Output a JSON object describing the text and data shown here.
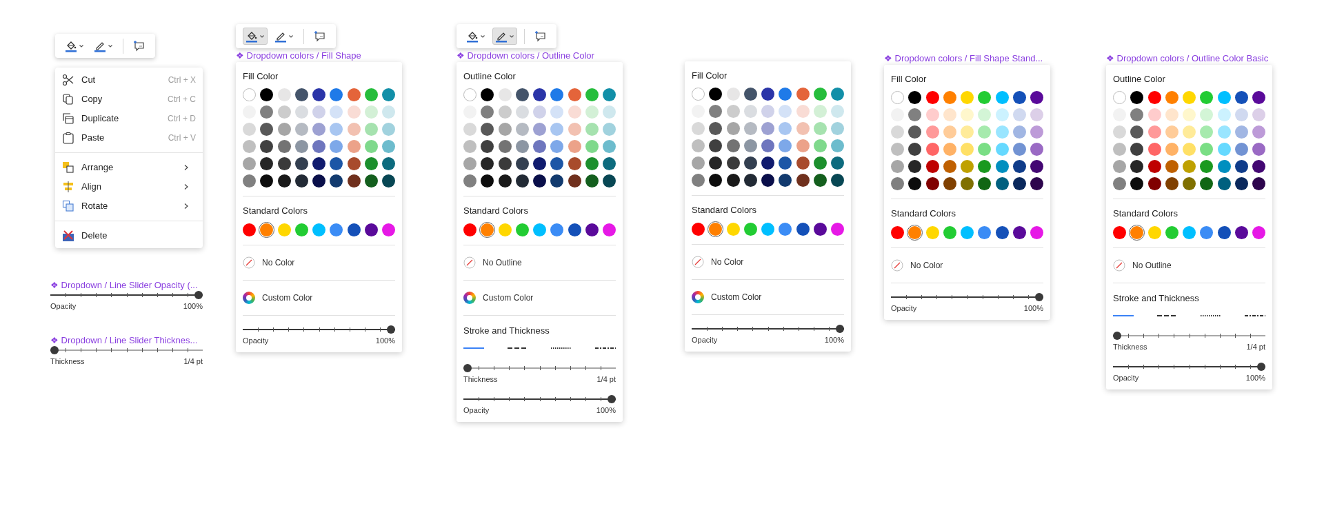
{
  "toolbars": [
    {
      "items": [
        {
          "kind": "fill",
          "active": false
        },
        {
          "kind": "outline",
          "active": false
        },
        {
          "kind": "comment",
          "active": false
        }
      ]
    },
    {
      "items": [
        {
          "kind": "fill",
          "active": true
        },
        {
          "kind": "outline",
          "active": false
        },
        {
          "kind": "comment",
          "active": false
        }
      ]
    },
    {
      "items": [
        {
          "kind": "fill",
          "active": false
        },
        {
          "kind": "outline",
          "active": true
        },
        {
          "kind": "comment",
          "active": false
        }
      ]
    }
  ],
  "context_menu": {
    "groups": [
      [
        {
          "label": "Cut",
          "shortcut": "Ctrl + X",
          "submenu": false
        },
        {
          "label": "Copy",
          "shortcut": "Ctrl + C",
          "submenu": false
        },
        {
          "label": "Duplicate",
          "shortcut": "Ctrl + D",
          "submenu": false
        },
        {
          "label": "Paste",
          "shortcut": "Ctrl + V",
          "submenu": false
        }
      ],
      [
        {
          "label": "Arrange",
          "submenu": true
        },
        {
          "label": "Align",
          "submenu": true
        },
        {
          "label": "Rotate",
          "submenu": true
        }
      ],
      [
        {
          "label": "Delete",
          "submenu": false
        }
      ]
    ]
  },
  "slider_components": [
    {
      "label": "❖ Dropdown / Line Slider Opacity (...",
      "slider": {
        "label": "Opacity",
        "reading": "100%",
        "level": 1
      }
    },
    {
      "label": "❖ Dropdown / Line Slider Thicknes...",
      "slider": {
        "label": "Thickness",
        "reading": "1/4 pt",
        "level": 0
      }
    }
  ],
  "panels": [
    {
      "label": "❖ Dropdown colors / Fill Shape",
      "title": "Fill Color",
      "theme_colors": [
        [
          {
            "color": "#ffffff"
          },
          {
            "color": "#000000"
          },
          {
            "color": "#e7e6e6"
          },
          {
            "color": "#44546a"
          },
          {
            "color": "#2b35a8"
          },
          {
            "color": "#1f7ae8"
          },
          {
            "color": "#e4643a"
          },
          {
            "color": "#26bd3c"
          },
          {
            "color": "#128fa8"
          }
        ],
        [
          {
            "color": "#f2f2f2"
          },
          {
            "color": "#808080"
          },
          {
            "color": "#cccccc"
          },
          {
            "color": "#dadde1"
          },
          {
            "color": "#d0d2ea"
          },
          {
            "color": "#d4e2f7"
          },
          {
            "color": "#f9dcd5"
          },
          {
            "color": "#d3f0d6"
          },
          {
            "color": "#cfe8ee"
          }
        ],
        [
          {
            "color": "#d9d9d9"
          },
          {
            "color": "#595959"
          },
          {
            "color": "#a6a6a6"
          },
          {
            "color": "#b5bac2"
          },
          {
            "color": "#9da1d2"
          },
          {
            "color": "#a8c6f1"
          },
          {
            "color": "#f2c1b1"
          },
          {
            "color": "#a6e2af"
          },
          {
            "color": "#a1d2de"
          }
        ],
        [
          {
            "color": "#bfbfbf"
          },
          {
            "color": "#404040"
          },
          {
            "color": "#737373"
          },
          {
            "color": "#8c96a3"
          },
          {
            "color": "#6e76be"
          },
          {
            "color": "#7da8e9"
          },
          {
            "color": "#eca289"
          },
          {
            "color": "#7fd98c"
          },
          {
            "color": "#6dbccd"
          }
        ],
        [
          {
            "color": "#a6a6a6"
          },
          {
            "color": "#262626"
          },
          {
            "color": "#3a3a3a"
          },
          {
            "color": "#333f50"
          },
          {
            "color": "#101b6e"
          },
          {
            "color": "#1c56a6"
          },
          {
            "color": "#a84b2c"
          },
          {
            "color": "#1c8f2d"
          },
          {
            "color": "#0d6b7e"
          }
        ],
        [
          {
            "color": "#808080"
          },
          {
            "color": "#0d0d0d"
          },
          {
            "color": "#191919"
          },
          {
            "color": "#222a35"
          },
          {
            "color": "#0a0f4a"
          },
          {
            "color": "#123a6e"
          },
          {
            "color": "#70301d"
          },
          {
            "color": "#145f1e"
          },
          {
            "color": "#084754"
          }
        ]
      ],
      "standard_title": "Standard Colors",
      "standard_colors": [
        {
          "color": "#ff0000",
          "selected": false
        },
        {
          "color": "#ff8000",
          "selected": true
        },
        {
          "color": "#ffd700",
          "selected": false
        },
        {
          "color": "#22cc33",
          "selected": false
        },
        {
          "color": "#00bfff",
          "selected": false
        },
        {
          "color": "#3b8cf5",
          "selected": false
        },
        {
          "color": "#1450b8",
          "selected": false
        },
        {
          "color": "#5a0a9a",
          "selected": false
        },
        {
          "color": "#e619e6",
          "selected": false
        }
      ],
      "options": [
        {
          "kind": "none",
          "label": "No Color"
        },
        {
          "kind": "custom",
          "label": "Custom Color"
        }
      ],
      "sliders": [
        {
          "label": "Opacity",
          "reading": "100%",
          "level": 1
        }
      ]
    },
    {
      "label": "❖ Dropdown colors / Outline Color",
      "title": "Outline Color",
      "theme_colors": [
        [
          {
            "color": "#ffffff"
          },
          {
            "color": "#000000"
          },
          {
            "color": "#e7e6e6"
          },
          {
            "color": "#44546a"
          },
          {
            "color": "#2b35a8"
          },
          {
            "color": "#1f7ae8"
          },
          {
            "color": "#e4643a"
          },
          {
            "color": "#26bd3c"
          },
          {
            "color": "#128fa8"
          }
        ],
        [
          {
            "color": "#f2f2f2"
          },
          {
            "color": "#808080"
          },
          {
            "color": "#cccccc"
          },
          {
            "color": "#dadde1"
          },
          {
            "color": "#d0d2ea"
          },
          {
            "color": "#d4e2f7"
          },
          {
            "color": "#f9dcd5"
          },
          {
            "color": "#d3f0d6"
          },
          {
            "color": "#cfe8ee"
          }
        ],
        [
          {
            "color": "#d9d9d9"
          },
          {
            "color": "#595959"
          },
          {
            "color": "#a6a6a6"
          },
          {
            "color": "#b5bac2"
          },
          {
            "color": "#9da1d2"
          },
          {
            "color": "#a8c6f1"
          },
          {
            "color": "#f2c1b1"
          },
          {
            "color": "#a6e2af"
          },
          {
            "color": "#a1d2de"
          }
        ],
        [
          {
            "color": "#bfbfbf"
          },
          {
            "color": "#404040"
          },
          {
            "color": "#737373"
          },
          {
            "color": "#8c96a3"
          },
          {
            "color": "#6e76be"
          },
          {
            "color": "#7da8e9"
          },
          {
            "color": "#eca289"
          },
          {
            "color": "#7fd98c"
          },
          {
            "color": "#6dbccd"
          }
        ],
        [
          {
            "color": "#a6a6a6"
          },
          {
            "color": "#262626"
          },
          {
            "color": "#3a3a3a"
          },
          {
            "color": "#333f50"
          },
          {
            "color": "#101b6e"
          },
          {
            "color": "#1c56a6"
          },
          {
            "color": "#a84b2c"
          },
          {
            "color": "#1c8f2d"
          },
          {
            "color": "#0d6b7e"
          }
        ],
        [
          {
            "color": "#808080"
          },
          {
            "color": "#0d0d0d"
          },
          {
            "color": "#191919"
          },
          {
            "color": "#222a35"
          },
          {
            "color": "#0a0f4a"
          },
          {
            "color": "#123a6e"
          },
          {
            "color": "#70301d"
          },
          {
            "color": "#145f1e"
          },
          {
            "color": "#084754"
          }
        ]
      ],
      "standard_title": "Standard Colors",
      "standard_colors": [
        {
          "color": "#ff0000",
          "selected": false
        },
        {
          "color": "#ff8000",
          "selected": true
        },
        {
          "color": "#ffd700",
          "selected": false
        },
        {
          "color": "#22cc33",
          "selected": false
        },
        {
          "color": "#00bfff",
          "selected": false
        },
        {
          "color": "#3b8cf5",
          "selected": false
        },
        {
          "color": "#1450b8",
          "selected": false
        },
        {
          "color": "#5a0a9a",
          "selected": false
        },
        {
          "color": "#e619e6",
          "selected": false
        }
      ],
      "options": [
        {
          "kind": "none",
          "label": "No Outline"
        },
        {
          "kind": "custom",
          "label": "Custom Color"
        }
      ],
      "stroke": {
        "title": "Stroke and Thickness",
        "styles": [
          {
            "kind": "solid",
            "selected": true
          },
          {
            "kind": "dashed",
            "selected": false
          },
          {
            "kind": "dotted",
            "selected": false
          },
          {
            "kind": "dashdot",
            "selected": false
          }
        ]
      },
      "sliders": [
        {
          "label": "Thickness",
          "reading": "1/4 pt",
          "level": 0
        },
        {
          "label": "Opacity",
          "reading": "100%",
          "level": 1
        }
      ]
    },
    {
      "title": "Fill Color",
      "theme_colors": [
        [
          {
            "color": "#ffffff"
          },
          {
            "color": "#000000"
          },
          {
            "color": "#e7e6e6"
          },
          {
            "color": "#44546a"
          },
          {
            "color": "#2b35a8"
          },
          {
            "color": "#1f7ae8"
          },
          {
            "color": "#e4643a"
          },
          {
            "color": "#26bd3c"
          },
          {
            "color": "#128fa8"
          }
        ],
        [
          {
            "color": "#f2f2f2"
          },
          {
            "color": "#808080"
          },
          {
            "color": "#cccccc"
          },
          {
            "color": "#dadde1"
          },
          {
            "color": "#d0d2ea"
          },
          {
            "color": "#d4e2f7"
          },
          {
            "color": "#f9dcd5"
          },
          {
            "color": "#d3f0d6"
          },
          {
            "color": "#cfe8ee"
          }
        ],
        [
          {
            "color": "#d9d9d9"
          },
          {
            "color": "#595959"
          },
          {
            "color": "#a6a6a6"
          },
          {
            "color": "#b5bac2"
          },
          {
            "color": "#9da1d2"
          },
          {
            "color": "#a8c6f1"
          },
          {
            "color": "#f2c1b1"
          },
          {
            "color": "#a6e2af"
          },
          {
            "color": "#a1d2de"
          }
        ],
        [
          {
            "color": "#bfbfbf"
          },
          {
            "color": "#404040"
          },
          {
            "color": "#737373"
          },
          {
            "color": "#8c96a3"
          },
          {
            "color": "#6e76be"
          },
          {
            "color": "#7da8e9"
          },
          {
            "color": "#eca289"
          },
          {
            "color": "#7fd98c"
          },
          {
            "color": "#6dbccd"
          }
        ],
        [
          {
            "color": "#a6a6a6"
          },
          {
            "color": "#262626"
          },
          {
            "color": "#3a3a3a"
          },
          {
            "color": "#333f50"
          },
          {
            "color": "#101b6e"
          },
          {
            "color": "#1c56a6"
          },
          {
            "color": "#a84b2c"
          },
          {
            "color": "#1c8f2d"
          },
          {
            "color": "#0d6b7e"
          }
        ],
        [
          {
            "color": "#808080"
          },
          {
            "color": "#0d0d0d"
          },
          {
            "color": "#191919"
          },
          {
            "color": "#222a35"
          },
          {
            "color": "#0a0f4a"
          },
          {
            "color": "#123a6e"
          },
          {
            "color": "#70301d"
          },
          {
            "color": "#145f1e"
          },
          {
            "color": "#084754"
          }
        ]
      ],
      "standard_title": "Standard Colors",
      "standard_colors": [
        {
          "color": "#ff0000",
          "selected": false
        },
        {
          "color": "#ff8000",
          "selected": true
        },
        {
          "color": "#ffd700",
          "selected": false
        },
        {
          "color": "#22cc33",
          "selected": false
        },
        {
          "color": "#00bfff",
          "selected": false
        },
        {
          "color": "#3b8cf5",
          "selected": false
        },
        {
          "color": "#1450b8",
          "selected": false
        },
        {
          "color": "#5a0a9a",
          "selected": false
        },
        {
          "color": "#e619e6",
          "selected": false
        }
      ],
      "options": [
        {
          "kind": "none",
          "label": "No Color"
        },
        {
          "kind": "custom",
          "label": "Custom Color"
        }
      ],
      "sliders": [
        {
          "label": "Opacity",
          "reading": "100%",
          "level": 1
        }
      ]
    },
    {
      "label": "❖ Dropdown colors / Fill Shape Stand...",
      "title": "Fill Color",
      "theme_colors": [
        [
          {
            "color": "#ffffff"
          },
          {
            "color": "#000000"
          },
          {
            "color": "#ff0000"
          },
          {
            "color": "#ff8000"
          },
          {
            "color": "#ffd700"
          },
          {
            "color": "#22cc33"
          },
          {
            "color": "#00bfff"
          },
          {
            "color": "#1450b8"
          },
          {
            "color": "#5a0a9a"
          }
        ],
        [
          {
            "color": "#f2f2f2"
          },
          {
            "color": "#808080"
          },
          {
            "color": "#ffcccc"
          },
          {
            "color": "#ffe5cc"
          },
          {
            "color": "#fff7cc"
          },
          {
            "color": "#d3f5d6"
          },
          {
            "color": "#ccf2ff"
          },
          {
            "color": "#d0d9f0"
          },
          {
            "color": "#dccfe8"
          }
        ],
        [
          {
            "color": "#d9d9d9"
          },
          {
            "color": "#5a5a5a"
          },
          {
            "color": "#ff9999"
          },
          {
            "color": "#ffcc99"
          },
          {
            "color": "#ffeb99"
          },
          {
            "color": "#a6eaad"
          },
          {
            "color": "#99e5ff"
          },
          {
            "color": "#a1b6e3"
          },
          {
            "color": "#bd9bd8"
          }
        ],
        [
          {
            "color": "#bfbfbf"
          },
          {
            "color": "#404040"
          },
          {
            "color": "#ff6666"
          },
          {
            "color": "#ffb266"
          },
          {
            "color": "#ffe066"
          },
          {
            "color": "#7ade85"
          },
          {
            "color": "#66d9ff"
          },
          {
            "color": "#7293d3"
          },
          {
            "color": "#9a6ac4"
          }
        ],
        [
          {
            "color": "#a6a6a6"
          },
          {
            "color": "#262626"
          },
          {
            "color": "#bf0000"
          },
          {
            "color": "#bf6000"
          },
          {
            "color": "#bfa100"
          },
          {
            "color": "#1a991f"
          },
          {
            "color": "#008fbf"
          },
          {
            "color": "#0f3c8a"
          },
          {
            "color": "#430773"
          }
        ],
        [
          {
            "color": "#808080"
          },
          {
            "color": "#0d0d0d"
          },
          {
            "color": "#800000"
          },
          {
            "color": "#804000"
          },
          {
            "color": "#807000"
          },
          {
            "color": "#116614"
          },
          {
            "color": "#00607f"
          },
          {
            "color": "#0a285c"
          },
          {
            "color": "#2d054d"
          }
        ]
      ],
      "standard_title": "Standard Colors",
      "standard_colors": [
        {
          "color": "#ff0000",
          "selected": false
        },
        {
          "color": "#ff8000",
          "selected": true
        },
        {
          "color": "#ffd700",
          "selected": false
        },
        {
          "color": "#22cc33",
          "selected": false
        },
        {
          "color": "#00bfff",
          "selected": false
        },
        {
          "color": "#3b8cf5",
          "selected": false
        },
        {
          "color": "#1450b8",
          "selected": false
        },
        {
          "color": "#5a0a9a",
          "selected": false
        },
        {
          "color": "#e619e6",
          "selected": false
        }
      ],
      "options": [
        {
          "kind": "none",
          "label": "No Color"
        }
      ],
      "sliders": [
        {
          "label": "Opacity",
          "reading": "100%",
          "level": 1
        }
      ]
    },
    {
      "label": "❖ Dropdown colors / Outline Color Basic",
      "title": "Outline Color",
      "theme_colors": [
        [
          {
            "color": "#ffffff"
          },
          {
            "color": "#000000"
          },
          {
            "color": "#ff0000"
          },
          {
            "color": "#ff8000"
          },
          {
            "color": "#ffd700"
          },
          {
            "color": "#22cc33"
          },
          {
            "color": "#00bfff"
          },
          {
            "color": "#1450b8"
          },
          {
            "color": "#5a0a9a"
          }
        ],
        [
          {
            "color": "#f2f2f2"
          },
          {
            "color": "#808080"
          },
          {
            "color": "#ffcccc"
          },
          {
            "color": "#ffe5cc"
          },
          {
            "color": "#fff7cc"
          },
          {
            "color": "#d3f5d6"
          },
          {
            "color": "#ccf2ff"
          },
          {
            "color": "#d0d9f0"
          },
          {
            "color": "#dccfe8"
          }
        ],
        [
          {
            "color": "#d9d9d9"
          },
          {
            "color": "#5a5a5a"
          },
          {
            "color": "#ff9999"
          },
          {
            "color": "#ffcc99"
          },
          {
            "color": "#ffeb99"
          },
          {
            "color": "#a6eaad"
          },
          {
            "color": "#99e5ff"
          },
          {
            "color": "#a1b6e3"
          },
          {
            "color": "#bd9bd8"
          }
        ],
        [
          {
            "color": "#bfbfbf"
          },
          {
            "color": "#404040"
          },
          {
            "color": "#ff6666"
          },
          {
            "color": "#ffb266"
          },
          {
            "color": "#ffe066"
          },
          {
            "color": "#7ade85"
          },
          {
            "color": "#66d9ff"
          },
          {
            "color": "#7293d3"
          },
          {
            "color": "#9a6ac4"
          }
        ],
        [
          {
            "color": "#a6a6a6"
          },
          {
            "color": "#262626"
          },
          {
            "color": "#bf0000"
          },
          {
            "color": "#bf6000"
          },
          {
            "color": "#bfa100"
          },
          {
            "color": "#1a991f"
          },
          {
            "color": "#008fbf"
          },
          {
            "color": "#0f3c8a"
          },
          {
            "color": "#430773"
          }
        ],
        [
          {
            "color": "#808080"
          },
          {
            "color": "#0d0d0d"
          },
          {
            "color": "#800000"
          },
          {
            "color": "#804000"
          },
          {
            "color": "#807000"
          },
          {
            "color": "#116614"
          },
          {
            "color": "#00607f"
          },
          {
            "color": "#0a285c"
          },
          {
            "color": "#2d054d"
          }
        ]
      ],
      "standard_title": "Standard Colors",
      "standard_colors": [
        {
          "color": "#ff0000",
          "selected": false
        },
        {
          "color": "#ff8000",
          "selected": true
        },
        {
          "color": "#ffd700",
          "selected": false
        },
        {
          "color": "#22cc33",
          "selected": false
        },
        {
          "color": "#00bfff",
          "selected": false
        },
        {
          "color": "#3b8cf5",
          "selected": false
        },
        {
          "color": "#1450b8",
          "selected": false
        },
        {
          "color": "#5a0a9a",
          "selected": false
        },
        {
          "color": "#e619e6",
          "selected": false
        }
      ],
      "options": [
        {
          "kind": "none",
          "label": "No Outline"
        }
      ],
      "stroke": {
        "title": "Stroke and Thickness",
        "styles": [
          {
            "kind": "solid",
            "selected": true
          },
          {
            "kind": "dashed",
            "selected": false
          },
          {
            "kind": "dotted",
            "selected": false
          },
          {
            "kind": "dashdot",
            "selected": false
          }
        ]
      },
      "sliders": [
        {
          "label": "Thickness",
          "reading": "1/4 pt",
          "level": 0
        },
        {
          "label": "Opacity",
          "reading": "100%",
          "level": 1
        }
      ]
    }
  ]
}
